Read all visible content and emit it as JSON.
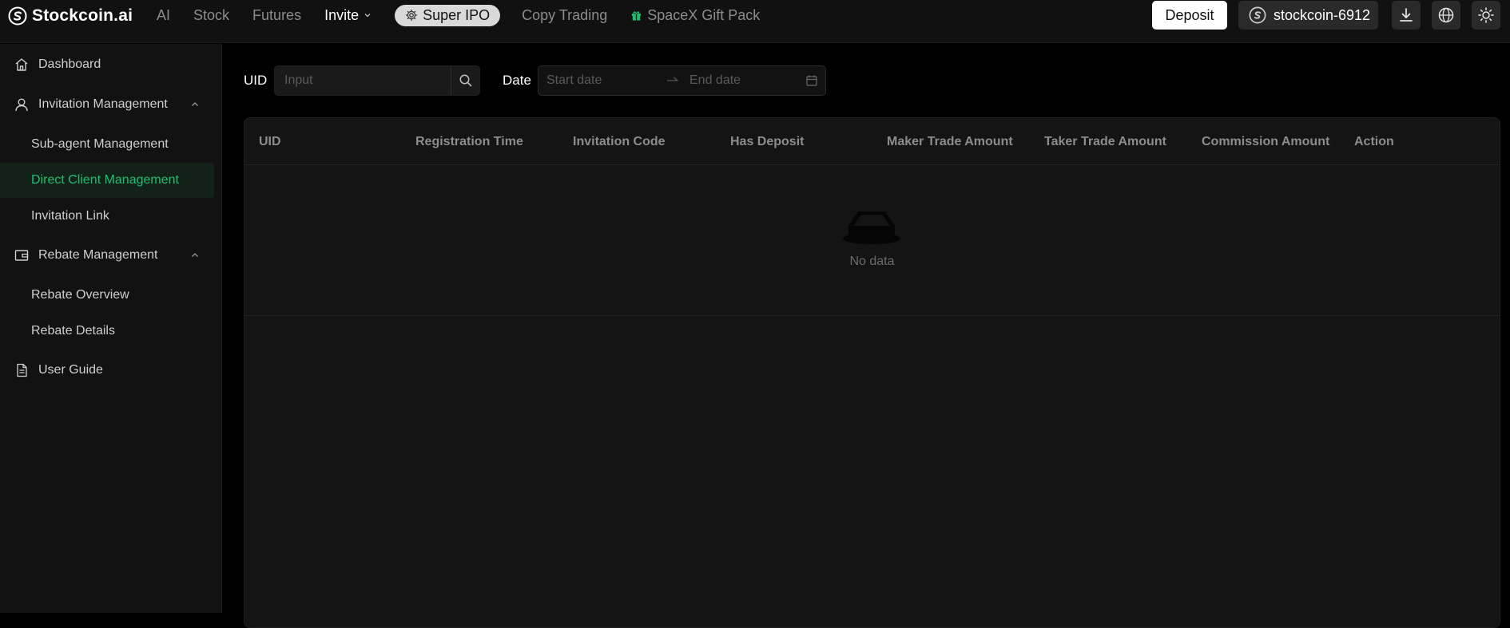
{
  "brand": {
    "name": "Stockcoin.ai"
  },
  "nav": {
    "ai": "AI",
    "stock": "Stock",
    "futures": "Futures",
    "invite": "Invite",
    "super_ipo": "Super IPO",
    "copy_trading": "Copy Trading",
    "spacex_gift": "SpaceX Gift Pack"
  },
  "header": {
    "deposit_label": "Deposit",
    "account_name": "stockcoin-6912"
  },
  "sidebar": {
    "dashboard": "Dashboard",
    "invitation_management": "Invitation Management",
    "sub_agent": "Sub-agent Management",
    "direct_client": "Direct Client Management",
    "invitation_link": "Invitation Link",
    "rebate_management": "Rebate Management",
    "rebate_overview": "Rebate Overview",
    "rebate_details": "Rebate Details",
    "user_guide": "User Guide"
  },
  "filters": {
    "uid_label": "UID",
    "uid_placeholder": "Input",
    "date_label": "Date",
    "start_placeholder": "Start date",
    "end_placeholder": "End date"
  },
  "table": {
    "columns": [
      "UID",
      "Registration Time",
      "Invitation Code",
      "Has Deposit",
      "Maker Trade Amount",
      "Taker Trade Amount",
      "Commission Amount",
      "Action"
    ],
    "empty_text": "No data"
  },
  "colors": {
    "accent_green": "#1dbf73",
    "background": "#000000",
    "panel": "#141414"
  }
}
